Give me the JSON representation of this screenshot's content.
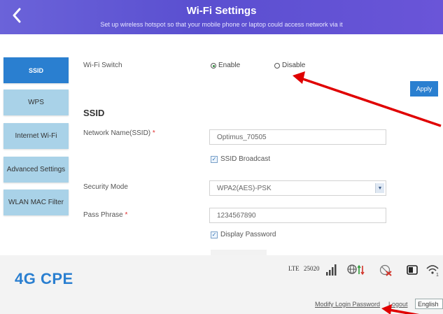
{
  "header": {
    "title": "Wi-Fi Settings",
    "subtitle": "Set up wireless hotspot so that your mobile phone or laptop could access network via it"
  },
  "sidebar": {
    "items": [
      {
        "label": "SSID",
        "active": true
      },
      {
        "label": "WPS"
      },
      {
        "label": "Internet Wi-Fi"
      },
      {
        "label": "Advanced Settings"
      },
      {
        "label": "WLAN MAC Filter"
      }
    ]
  },
  "wifi_switch": {
    "label": "Wi-Fi Switch",
    "enable_label": "Enable",
    "disable_label": "Disable",
    "selected": "Enable"
  },
  "apply_label": "Apply",
  "ssid_section": {
    "title": "SSID",
    "network_name_label": "Network Name(SSID)",
    "network_name_value": "Optimus_70505",
    "ssid_broadcast_label": "SSID Broadcast",
    "ssid_broadcast_checked": true,
    "security_mode_label": "Security Mode",
    "security_mode_value": "WPA2(AES)-PSK",
    "pass_phrase_label": "Pass Phrase",
    "pass_phrase_value": "1234567890",
    "display_password_label": "Display Password",
    "display_password_checked": true,
    "required_mark": "*"
  },
  "footer": {
    "brand": "4G CPE",
    "network_type": "LTE",
    "network_code": "25020",
    "modify_password_label": "Modify Login Password",
    "logout_label": "Logout",
    "language_value": "English"
  },
  "icons": [
    "back-icon",
    "signal-icon",
    "network-globe-icon",
    "data-arrows-icon",
    "wifi-disabled-icon",
    "battery-icon",
    "wifi-icon",
    "radio-icon",
    "checkbox-check-icon",
    "dropdown-arrow-icon"
  ],
  "colors": {
    "header": "#5a4fd0",
    "accent": "#2a7fd0",
    "sidebar": "#a9d2e8",
    "annotation_arrow": "#e00000"
  }
}
